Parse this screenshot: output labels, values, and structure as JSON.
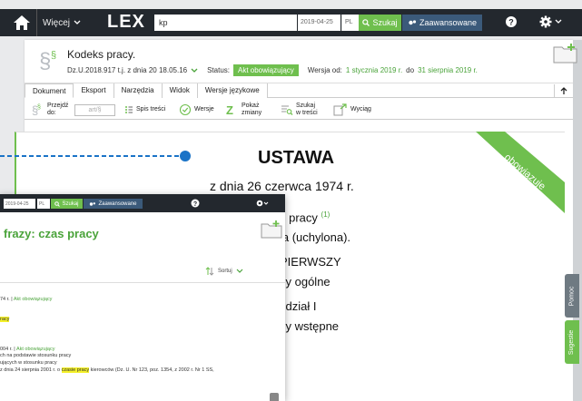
{
  "topbar": {
    "more_label": "Więcej",
    "logo": "LEX",
    "search_value": "kp",
    "date_value": "2019-04-25",
    "lang_value": "PL",
    "search_button": "Szukaj",
    "advanced_button": "Zaawansowane"
  },
  "document": {
    "title": "Kodeks pracy.",
    "ref": "Dz.U.2018.917 t.j. z dnia 20 18.05.16",
    "status_label": "Status:",
    "status_value": "Akt obowiązujący",
    "version_prefix": "Wersja od:",
    "version_from": "1 stycznia 2019 r.",
    "version_to_prefix": "do",
    "version_to": "31 sierpnia 2019 r.",
    "tabs": [
      "Dokument",
      "Eksport",
      "Narzędzia",
      "Widok",
      "Wersje językowe"
    ],
    "toolbar": {
      "goto_label_1": "Przejdź",
      "goto_label_2": "do:",
      "art_placeholder": "art/§",
      "toc": "Spis treści",
      "versions": "Wersje",
      "show_changes_1": "Pokaż",
      "show_changes_2": "zmiany",
      "search_in_1": "Szukaj",
      "search_in_2": "w treści",
      "extract": "Wyciąg"
    },
    "ribbon": "obowiązuje",
    "heading": "USTAWA",
    "date_line": "z dnia 26 czerwca 1974 r.",
    "line1": "s pracy",
    "line1_sup": "(1)",
    "line2": "la (uchylona).",
    "line3": "PIERWSZY",
    "line4": "sy ogólne",
    "line5": "zdział I",
    "line6": "sy wstępne"
  },
  "side": {
    "help": "Pomoc",
    "suggestions": "Sugestie"
  },
  "popup": {
    "date_value": "2019-04-25",
    "lang_value": "PL",
    "search_button": "Szukaj",
    "advanced_button": "Zaawansowane",
    "heading": "frazy: czas pracy",
    "sort_label": "Sortuj",
    "r1_pre": "74 r. | ",
    "r1_status": "Akt obowiązujący",
    "r2_hl": "racy",
    "r3_pre": "004 r. | ",
    "r3_status": "Akt obowiązujący",
    "r4": "ch na podstawie stosunku pracy",
    "r5": "ujących w stosunku pracy",
    "r6_pre": "z dnia 24 sierpnia 2001 r. o ",
    "r6_hl": "czasie pracy",
    "r6_post": " kierowców (Dz. U. Nr 123, poz. 1354, z 2002 r. Nr 1 SS,"
  },
  "colors": {
    "accent_green": "#6fbf4e",
    "navbar": "#23282e",
    "advanced_blue": "#3b5a7a",
    "highlight": "#f4f02a",
    "callout_blue": "#1a73c7"
  }
}
